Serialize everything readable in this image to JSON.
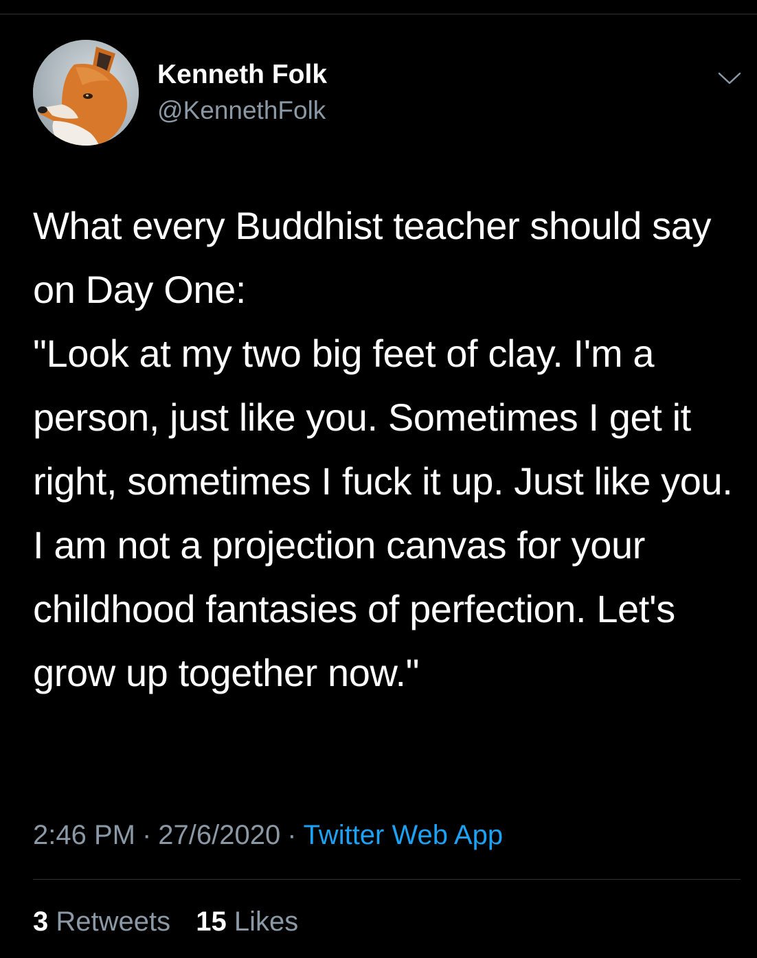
{
  "author": {
    "display_name": "Kenneth Folk",
    "handle": "@KennethFolk"
  },
  "tweet": {
    "text": "What every Buddhist teacher should say on Day One:\n\"Look at my two big feet of clay. I'm a person, just like you. Sometimes I get it right, sometimes I fuck it up. Just like you. I am not a projection canvas for your childhood fantasies of perfection. Let's grow up together now.\""
  },
  "meta": {
    "time": "2:46 PM",
    "separator": "·",
    "date": "27/6/2020",
    "source": "Twitter Web App"
  },
  "stats": {
    "retweets_count": "3",
    "retweets_label": "Retweets",
    "likes_count": "15",
    "likes_label": "Likes"
  },
  "icons": {
    "menu": "chevron-down-icon",
    "avatar": "fox-avatar"
  },
  "colors": {
    "background": "#000000",
    "text": "#ffffff",
    "secondary": "#8b98a5",
    "link": "#1da1f2",
    "divider": "#2f3336"
  }
}
